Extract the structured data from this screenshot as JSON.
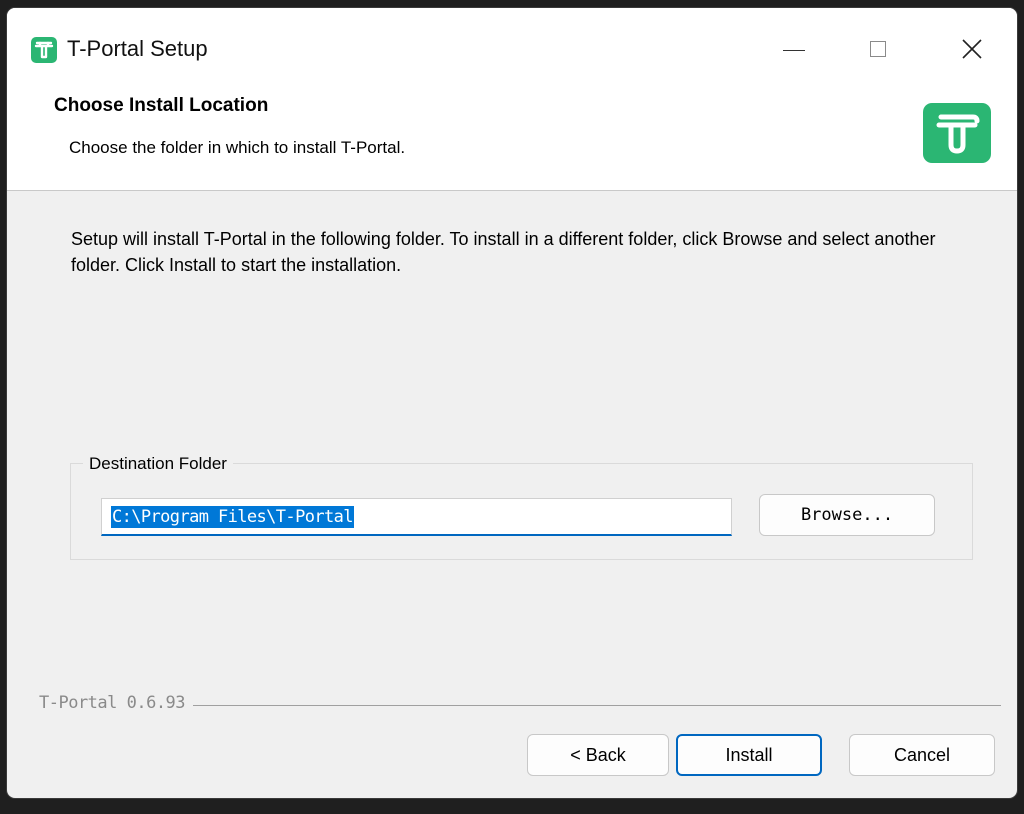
{
  "window": {
    "title": "T-Portal Setup",
    "icon": "t-portal-logo-icon",
    "controls": {
      "minimize": "minimize-icon",
      "maximize": "maximize-icon",
      "close": "close-icon"
    }
  },
  "header": {
    "title": "Choose Install Location",
    "subtitle": "Choose the folder in which to install T-Portal.",
    "logo": "t-portal-logo-icon"
  },
  "body": {
    "description": "Setup will install T-Portal in the following folder. To install in a different folder, click Browse and select another folder. Click Install to start the installation."
  },
  "destination": {
    "group_label": "Destination Folder",
    "path_value": "C:\\Program Files\\T-Portal",
    "browse_label": "Browse..."
  },
  "footer": {
    "version": "T-Portal 0.6.93",
    "back_label": "< Back",
    "install_label": "Install",
    "cancel_label": "Cancel"
  },
  "colors": {
    "accent": "#2bb673",
    "focus": "#0067c0",
    "selection": "#0078d7"
  }
}
